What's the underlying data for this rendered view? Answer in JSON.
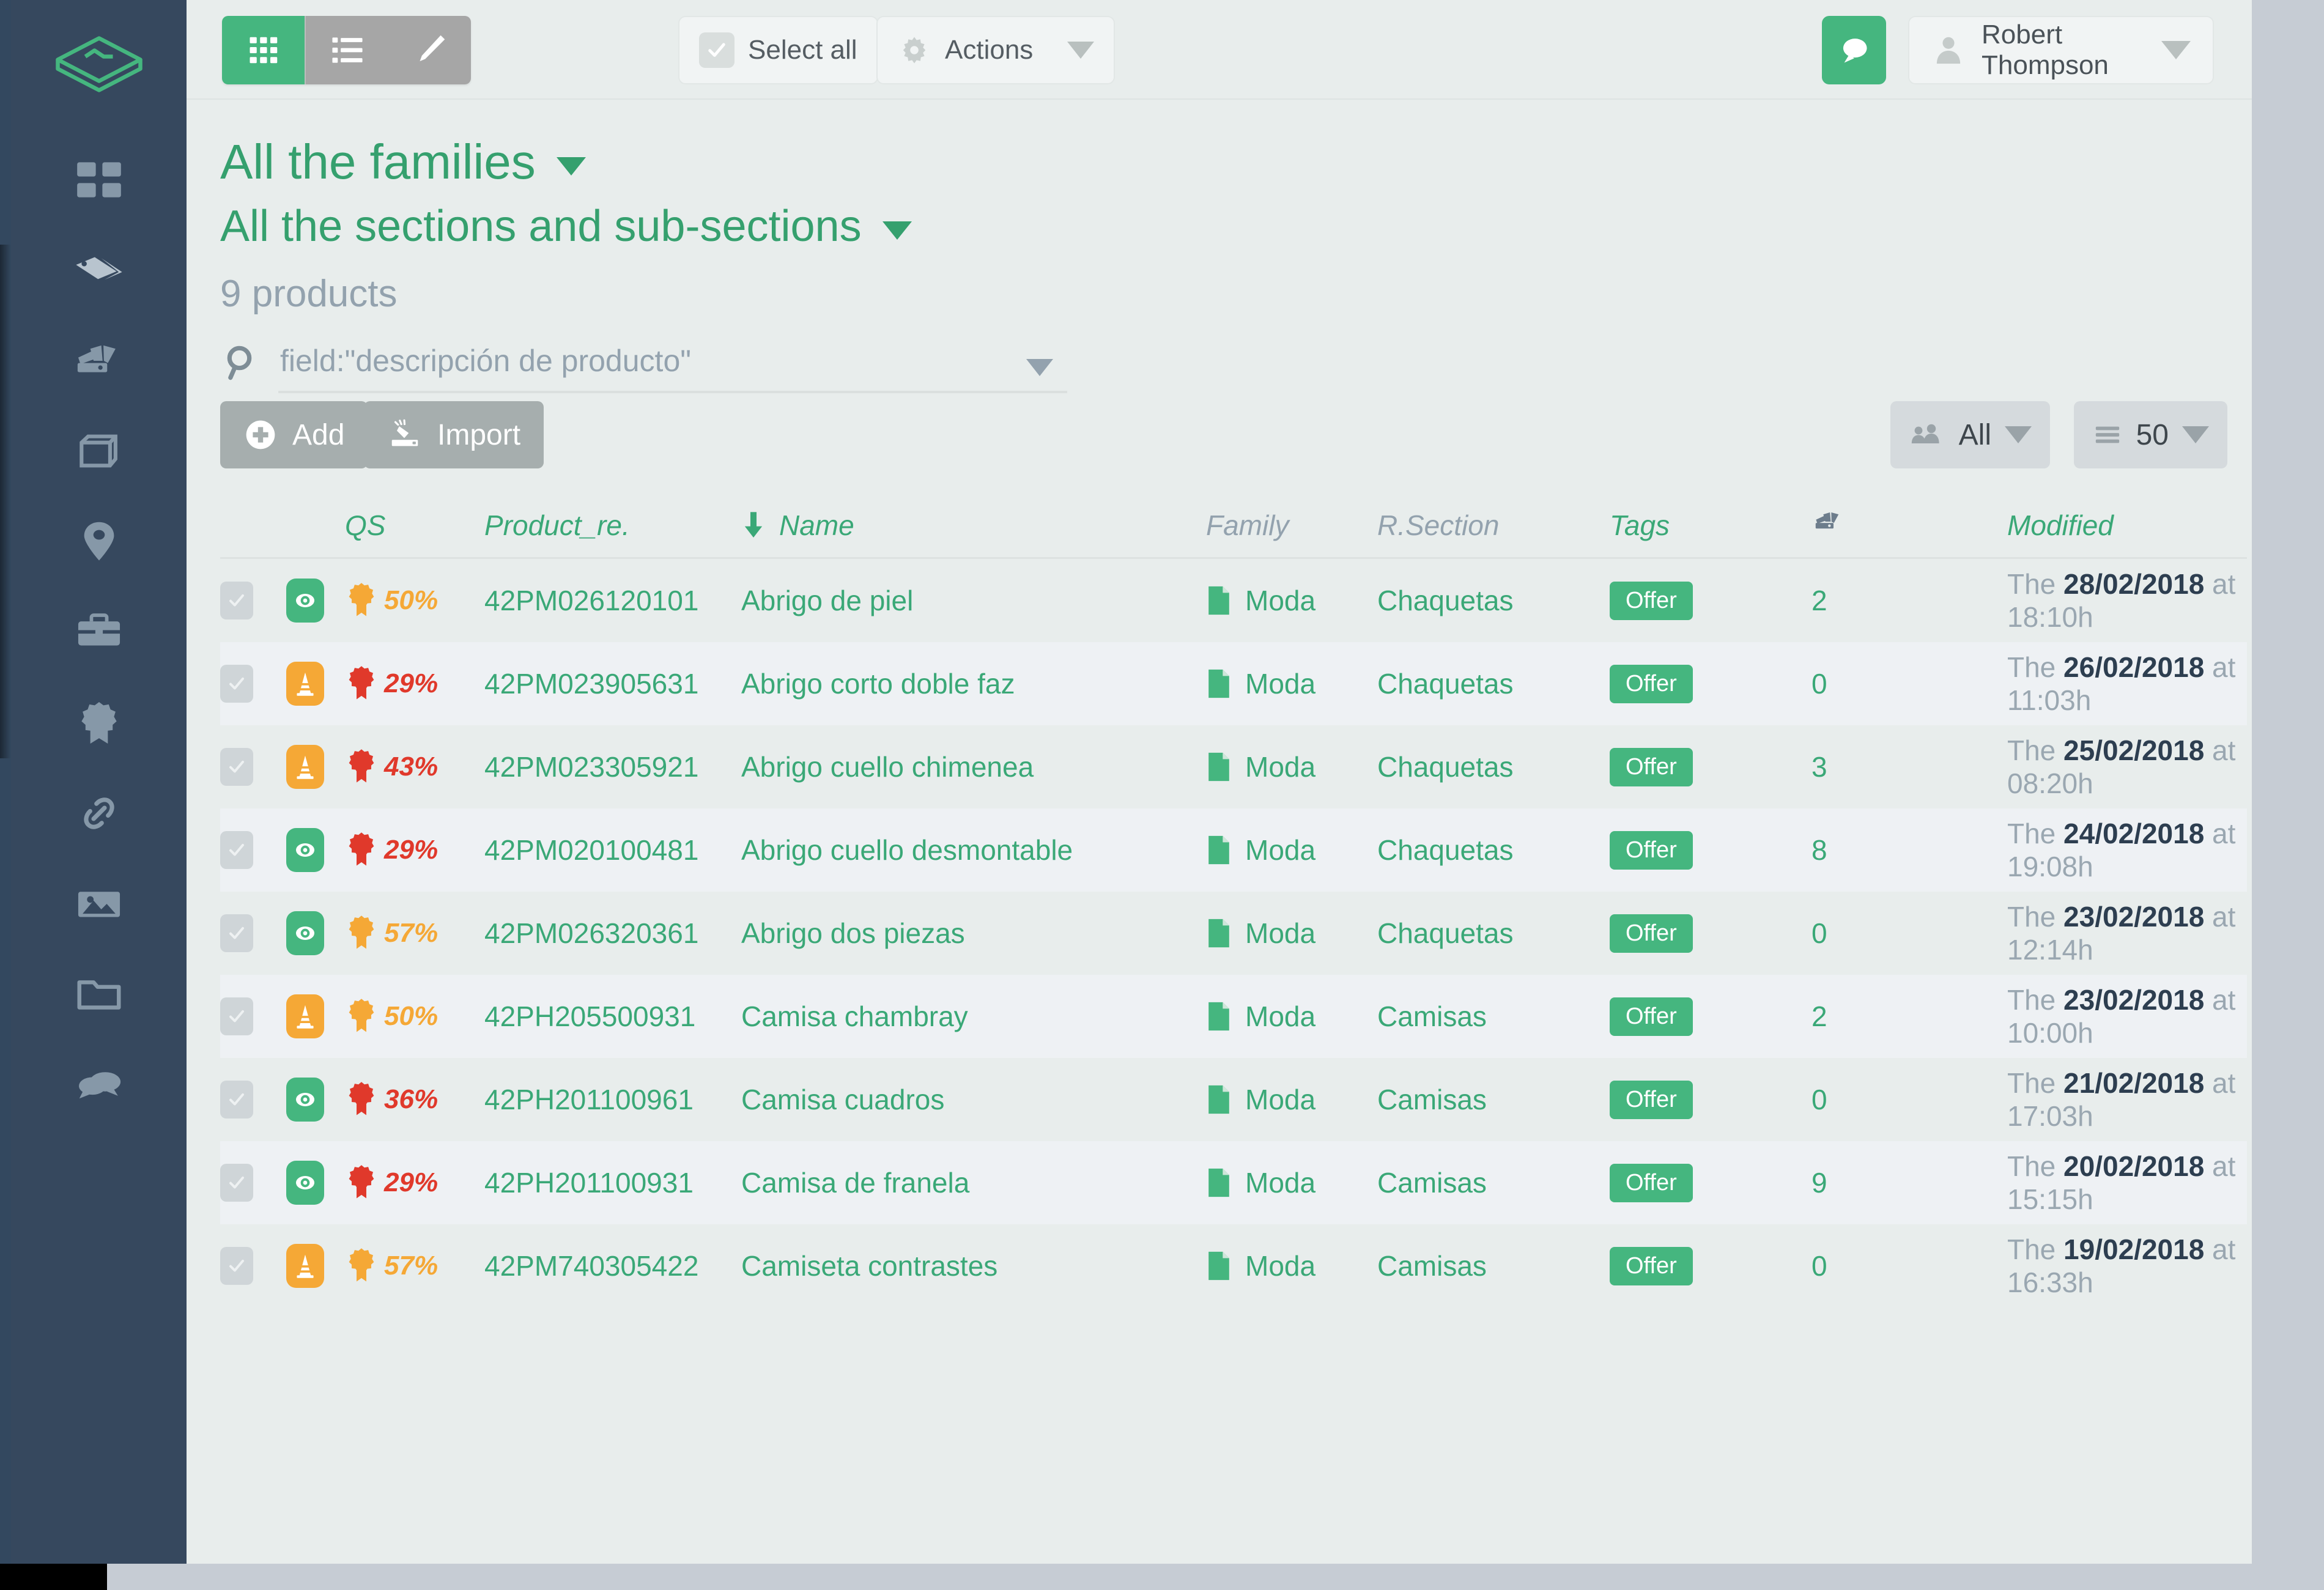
{
  "topbar": {
    "view_modes": [
      {
        "name": "grid",
        "icon": "grid-icon",
        "active": true
      },
      {
        "name": "list",
        "icon": "list-icon",
        "active": false
      },
      {
        "name": "edit",
        "icon": "pencil-icon",
        "active": false
      }
    ],
    "select_all_label": "Select all",
    "actions_label": "Actions",
    "chat_icon": "chat-bubble-icon",
    "user_name": "Robert Thompson"
  },
  "filters": {
    "family_label": "All the families",
    "section_label": "All the sections and sub-sections",
    "product_count": "9 products"
  },
  "search": {
    "value": "field:\"descripción de producto\"",
    "placeholder": "field:\"descripción de producto\""
  },
  "toolbar": {
    "add_label": "Add",
    "import_label": "Import",
    "scope_label": "All",
    "page_size_label": "50"
  },
  "table": {
    "headers": {
      "qs": "QS",
      "reference": "Product_re.",
      "name": "Name",
      "family": "Family",
      "section": "R.Section",
      "tags": "Tags",
      "attachments_icon": "swatches-icon",
      "modified": "Modified"
    },
    "sort": {
      "column": "Name",
      "direction": "down"
    },
    "rows": [
      {
        "status": "eye",
        "status_color": "green",
        "qs": "50%",
        "qs_color": "orange",
        "ref": "42PM026120101",
        "name": "Abrigo de piel",
        "family": "Moda",
        "section": "Chaquetas",
        "tag": "Offer",
        "count": "2",
        "mod_pre": "The ",
        "mod_date": "28/02/2018",
        "mod_post": " at 18:10h"
      },
      {
        "status": "cone",
        "status_color": "orange",
        "qs": "29%",
        "qs_color": "red",
        "ref": "42PM023905631",
        "name": "Abrigo corto doble faz",
        "family": "Moda",
        "section": "Chaquetas",
        "tag": "Offer",
        "count": "0",
        "mod_pre": "The ",
        "mod_date": "26/02/2018",
        "mod_post": " at 11:03h"
      },
      {
        "status": "cone",
        "status_color": "orange",
        "qs": "43%",
        "qs_color": "red",
        "ref": "42PM023305921",
        "name": "Abrigo cuello chimenea",
        "family": "Moda",
        "section": "Chaquetas",
        "tag": "Offer",
        "count": "3",
        "mod_pre": "The ",
        "mod_date": "25/02/2018",
        "mod_post": " at 08:20h"
      },
      {
        "status": "eye",
        "status_color": "green",
        "qs": "29%",
        "qs_color": "red",
        "ref": "42PM020100481",
        "name": "Abrigo cuello desmontable",
        "family": "Moda",
        "section": "Chaquetas",
        "tag": "Offer",
        "count": "8",
        "mod_pre": "The ",
        "mod_date": "24/02/2018",
        "mod_post": " at 19:08h"
      },
      {
        "status": "eye",
        "status_color": "green",
        "qs": "57%",
        "qs_color": "orange",
        "ref": "42PM026320361",
        "name": "Abrigo dos piezas",
        "family": "Moda",
        "section": "Chaquetas",
        "tag": "Offer",
        "count": "0",
        "mod_pre": "The ",
        "mod_date": "23/02/2018",
        "mod_post": " at 12:14h"
      },
      {
        "status": "cone",
        "status_color": "orange",
        "qs": "50%",
        "qs_color": "orange",
        "ref": "42PH205500931",
        "name": "Camisa chambray",
        "family": "Moda",
        "section": "Camisas",
        "tag": "Offer",
        "count": "2",
        "mod_pre": "The ",
        "mod_date": "23/02/2018",
        "mod_post": " at 10:00h"
      },
      {
        "status": "eye",
        "status_color": "green",
        "qs": "36%",
        "qs_color": "red",
        "ref": "42PH201100961",
        "name": "Camisa cuadros",
        "family": "Moda",
        "section": "Camisas",
        "tag": "Offer",
        "count": "0",
        "mod_pre": "The ",
        "mod_date": "21/02/2018",
        "mod_post": " at 17:03h"
      },
      {
        "status": "eye",
        "status_color": "green",
        "qs": "29%",
        "qs_color": "red",
        "ref": "42PH201100931",
        "name": "Camisa de franela",
        "family": "Moda",
        "section": "Camisas",
        "tag": "Offer",
        "count": "9",
        "mod_pre": "The ",
        "mod_date": "20/02/2018",
        "mod_post": " at 15:15h"
      },
      {
        "status": "cone",
        "status_color": "orange",
        "qs": "57%",
        "qs_color": "orange",
        "ref": "42PM740305422",
        "name": "Camiseta contrastes",
        "family": "Moda",
        "section": "Camisas",
        "tag": "Offer",
        "count": "0",
        "mod_pre": "The ",
        "mod_date": "19/02/2018",
        "mod_post": " at 16:33h"
      }
    ]
  },
  "sidebar": {
    "logo_icon": "layers-logo-icon",
    "items": [
      {
        "icon": "dashboard-grid-icon",
        "name": "dashboard"
      },
      {
        "icon": "tags-icon",
        "name": "tags"
      },
      {
        "icon": "color-swatches-icon",
        "name": "swatches"
      },
      {
        "icon": "box-icon",
        "name": "products"
      },
      {
        "icon": "location-pin-icon",
        "name": "locations"
      },
      {
        "icon": "briefcase-icon",
        "name": "briefcase"
      },
      {
        "icon": "award-ribbon-icon",
        "name": "quality"
      },
      {
        "icon": "link-chain-icon",
        "name": "links"
      },
      {
        "icon": "image-icon",
        "name": "media"
      },
      {
        "icon": "folder-icon",
        "name": "folders"
      },
      {
        "icon": "chat-bubbles-icon",
        "name": "messages"
      }
    ]
  },
  "colors": {
    "brand_green": "#45b67f",
    "text_green": "#3aa877",
    "sidebar_bg": "#36485e",
    "orange": "#f5a836",
    "red": "#e0392b",
    "slate": "#93a2ae"
  }
}
